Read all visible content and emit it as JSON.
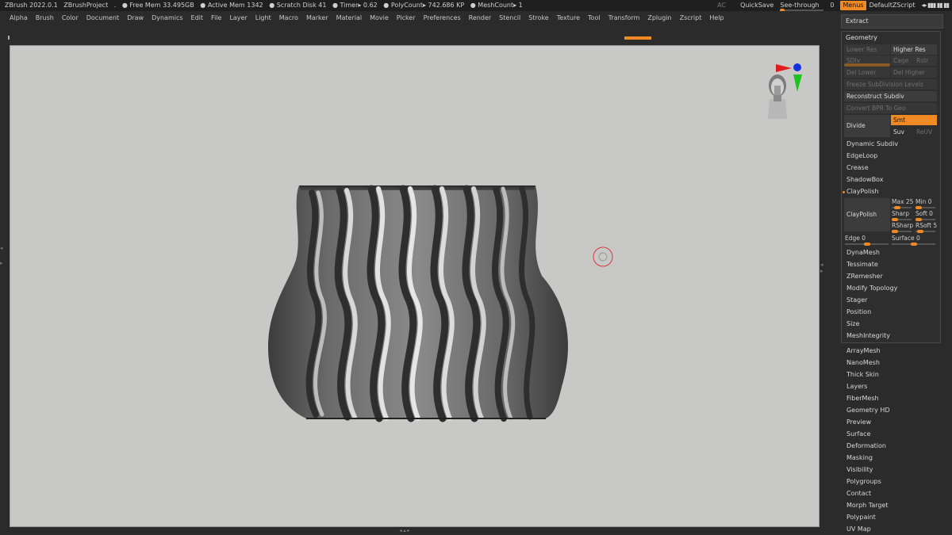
{
  "titlebar": {
    "app": "ZBrush 2022.0.1",
    "project": "ZBrushProject",
    "dot": ".",
    "free_mem": "● Free Mem 33.495GB",
    "active_mem": "● Active Mem 1342",
    "scratch": "● Scratch Disk 41",
    "timer": "● Timer▸ 0.62",
    "polycount": "● PolyCount▸ 742.686 KP",
    "meshcount": "● MeshCount▸ 1",
    "ac": "AC",
    "quicksave": "QuickSave",
    "see_through": "See-through",
    "see_through_value": "0",
    "menus": "Menus",
    "default_zscript": "DefaultZScript"
  },
  "menubar": [
    "Alpha",
    "Brush",
    "Color",
    "Document",
    "Draw",
    "Dynamics",
    "Edit",
    "File",
    "Layer",
    "Light",
    "Macro",
    "Marker",
    "Material",
    "Movie",
    "Picker",
    "Preferences",
    "Render",
    "Stencil",
    "Stroke",
    "Texture",
    "Tool",
    "Transform",
    "Zplugin",
    "Zscript",
    "Help"
  ],
  "panel": {
    "extract": "Extract",
    "geometry": "Geometry",
    "lower_res": "Lower Res",
    "higher_res": "Higher Res",
    "sdiv": "SDiv",
    "cage": "Cage",
    "rstr": "Rstr",
    "del_lower": "Del Lower",
    "del_higher": "Del Higher",
    "freeze": "Freeze SubDivision Levels",
    "reconstruct": "Reconstruct Subdiv",
    "convert_bpr": "Convert BPR To Geo",
    "divide": "Divide",
    "smt": "Smt",
    "suv": "Suv",
    "reuv": "ReUV",
    "dynamic_subdiv": "Dynamic Subdiv",
    "edgeloop": "EdgeLoop",
    "crease": "Crease",
    "shadowbox": "ShadowBox",
    "claypolish_header": "ClayPolish",
    "claypolish_btn": "ClayPolish",
    "max": "Max 25",
    "min": "Min 0",
    "sharp": "Sharp",
    "soft": "Soft 0",
    "rsharp": "RSharp",
    "rsoft": "RSoft 5",
    "edge": "Edge 0",
    "surface": "Surface 0",
    "dynamesh": "DynaMesh",
    "tessimate": "Tessimate",
    "zremesher": "ZRemesher",
    "modify_topology": "Modify Topology",
    "stager": "Stager",
    "position": "Position",
    "size": "Size",
    "meshintegrity": "MeshIntegrity",
    "list": [
      "ArrayMesh",
      "NanoMesh",
      "Thick Skin",
      "Layers",
      "FiberMesh",
      "Geometry HD",
      "Preview",
      "Surface",
      "Deformation",
      "Masking",
      "Visibility",
      "Polygroups",
      "Contact",
      "Morph Target",
      "Polypaint",
      "UV Map"
    ]
  },
  "colors": {
    "accent": "#f08a24",
    "canvas": "#c8c8c6",
    "panel": "#2b2b2b"
  }
}
